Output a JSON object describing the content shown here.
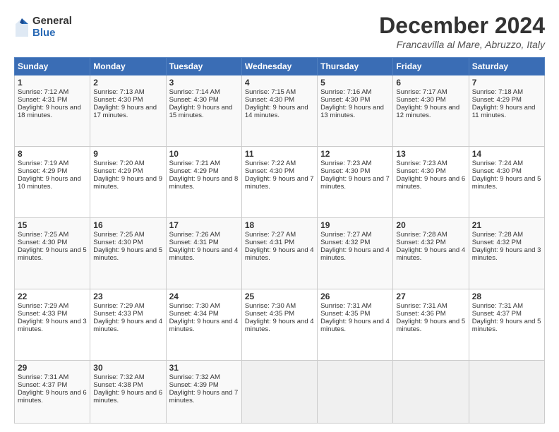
{
  "logo": {
    "general": "General",
    "blue": "Blue"
  },
  "title": "December 2024",
  "location": "Francavilla al Mare, Abruzzo, Italy",
  "headers": [
    "Sunday",
    "Monday",
    "Tuesday",
    "Wednesday",
    "Thursday",
    "Friday",
    "Saturday"
  ],
  "weeks": [
    [
      {
        "day": "1",
        "sunrise": "7:12 AM",
        "sunset": "4:31 PM",
        "daylight": "9 hours and 18 minutes."
      },
      {
        "day": "2",
        "sunrise": "7:13 AM",
        "sunset": "4:30 PM",
        "daylight": "9 hours and 17 minutes."
      },
      {
        "day": "3",
        "sunrise": "7:14 AM",
        "sunset": "4:30 PM",
        "daylight": "9 hours and 15 minutes."
      },
      {
        "day": "4",
        "sunrise": "7:15 AM",
        "sunset": "4:30 PM",
        "daylight": "9 hours and 14 minutes."
      },
      {
        "day": "5",
        "sunrise": "7:16 AM",
        "sunset": "4:30 PM",
        "daylight": "9 hours and 13 minutes."
      },
      {
        "day": "6",
        "sunrise": "7:17 AM",
        "sunset": "4:30 PM",
        "daylight": "9 hours and 12 minutes."
      },
      {
        "day": "7",
        "sunrise": "7:18 AM",
        "sunset": "4:29 PM",
        "daylight": "9 hours and 11 minutes."
      }
    ],
    [
      {
        "day": "8",
        "sunrise": "7:19 AM",
        "sunset": "4:29 PM",
        "daylight": "9 hours and 10 minutes."
      },
      {
        "day": "9",
        "sunrise": "7:20 AM",
        "sunset": "4:29 PM",
        "daylight": "9 hours and 9 minutes."
      },
      {
        "day": "10",
        "sunrise": "7:21 AM",
        "sunset": "4:29 PM",
        "daylight": "9 hours and 8 minutes."
      },
      {
        "day": "11",
        "sunrise": "7:22 AM",
        "sunset": "4:30 PM",
        "daylight": "9 hours and 7 minutes."
      },
      {
        "day": "12",
        "sunrise": "7:23 AM",
        "sunset": "4:30 PM",
        "daylight": "9 hours and 7 minutes."
      },
      {
        "day": "13",
        "sunrise": "7:23 AM",
        "sunset": "4:30 PM",
        "daylight": "9 hours and 6 minutes."
      },
      {
        "day": "14",
        "sunrise": "7:24 AM",
        "sunset": "4:30 PM",
        "daylight": "9 hours and 5 minutes."
      }
    ],
    [
      {
        "day": "15",
        "sunrise": "7:25 AM",
        "sunset": "4:30 PM",
        "daylight": "9 hours and 5 minutes."
      },
      {
        "day": "16",
        "sunrise": "7:25 AM",
        "sunset": "4:30 PM",
        "daylight": "9 hours and 5 minutes."
      },
      {
        "day": "17",
        "sunrise": "7:26 AM",
        "sunset": "4:31 PM",
        "daylight": "9 hours and 4 minutes."
      },
      {
        "day": "18",
        "sunrise": "7:27 AM",
        "sunset": "4:31 PM",
        "daylight": "9 hours and 4 minutes."
      },
      {
        "day": "19",
        "sunrise": "7:27 AM",
        "sunset": "4:32 PM",
        "daylight": "9 hours and 4 minutes."
      },
      {
        "day": "20",
        "sunrise": "7:28 AM",
        "sunset": "4:32 PM",
        "daylight": "9 hours and 4 minutes."
      },
      {
        "day": "21",
        "sunrise": "7:28 AM",
        "sunset": "4:32 PM",
        "daylight": "9 hours and 3 minutes."
      }
    ],
    [
      {
        "day": "22",
        "sunrise": "7:29 AM",
        "sunset": "4:33 PM",
        "daylight": "9 hours and 3 minutes."
      },
      {
        "day": "23",
        "sunrise": "7:29 AM",
        "sunset": "4:33 PM",
        "daylight": "9 hours and 4 minutes."
      },
      {
        "day": "24",
        "sunrise": "7:30 AM",
        "sunset": "4:34 PM",
        "daylight": "9 hours and 4 minutes."
      },
      {
        "day": "25",
        "sunrise": "7:30 AM",
        "sunset": "4:35 PM",
        "daylight": "9 hours and 4 minutes."
      },
      {
        "day": "26",
        "sunrise": "7:31 AM",
        "sunset": "4:35 PM",
        "daylight": "9 hours and 4 minutes."
      },
      {
        "day": "27",
        "sunrise": "7:31 AM",
        "sunset": "4:36 PM",
        "daylight": "9 hours and 5 minutes."
      },
      {
        "day": "28",
        "sunrise": "7:31 AM",
        "sunset": "4:37 PM",
        "daylight": "9 hours and 5 minutes."
      }
    ],
    [
      {
        "day": "29",
        "sunrise": "7:31 AM",
        "sunset": "4:37 PM",
        "daylight": "9 hours and 6 minutes."
      },
      {
        "day": "30",
        "sunrise": "7:32 AM",
        "sunset": "4:38 PM",
        "daylight": "9 hours and 6 minutes."
      },
      {
        "day": "31",
        "sunrise": "7:32 AM",
        "sunset": "4:39 PM",
        "daylight": "9 hours and 7 minutes."
      },
      null,
      null,
      null,
      null
    ]
  ],
  "labels": {
    "sunrise_prefix": "Sunrise: ",
    "sunset_prefix": "Sunset: ",
    "daylight_prefix": "Daylight: "
  }
}
